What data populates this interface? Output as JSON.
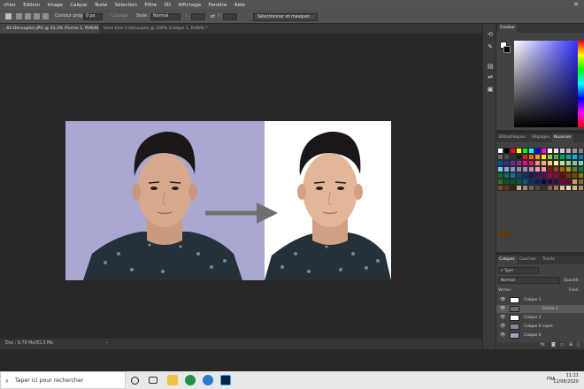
{
  "menubar": {
    "items": [
      "chier",
      "Edition",
      "Image",
      "Calque",
      "Texte",
      "Sélection",
      "Filtre",
      "3D",
      "Affichage",
      "Fenêtre",
      "Aide"
    ],
    "close_glyph": "✕"
  },
  "options": {
    "contour_label": "Contour progr. :",
    "contour_value": "0 px",
    "lissage": "Lissage",
    "style_label": "Style :",
    "style_value": "Normal",
    "l_label": "L :",
    "h_label": "H :",
    "select_mask_button": "Sélectionner et masquer..."
  },
  "tabs": [
    {
      "label": "...60-Découpée).JPG @ 33,3% (Forme 1, RVB/8) *",
      "active": true
    },
    {
      "label": "Sans titre-1-Découpée @ 100% (Calque 1, RVB/8) *",
      "active": false
    }
  ],
  "status": {
    "text": "Doc : 9,79 Mo/83,3 Mo"
  },
  "panels": {
    "color_tab": "Couleur",
    "library_tabs": [
      "Bibliothèques",
      "Réglages",
      "Nuancier"
    ],
    "layer_tabs": [
      "Calques",
      "Couches",
      "Tracés"
    ],
    "filter_kind": "Type",
    "blend_mode": "Normal",
    "opacity_label": "Opacité :",
    "lock_label": "Verrou :",
    "fill_label": "Fond :",
    "layers": [
      {
        "name": "Calque 1",
        "selected": false
      },
      {
        "name": "Forme 1",
        "selected": true
      },
      {
        "name": "Calque 2",
        "selected": false
      },
      {
        "name": "Calque 0 copie",
        "selected": false
      },
      {
        "name": "Calque 0",
        "selected": false
      }
    ]
  },
  "swatch_colors": [
    "#ffffff",
    "#000000",
    "#ff0000",
    "#ffff00",
    "#00ff00",
    "#00ffff",
    "#0000ff",
    "#ff00ff",
    "#ffffff",
    "#e6e6e6",
    "#cccccc",
    "#b3b3b3",
    "#999999",
    "#808080",
    "#666666",
    "#4d4d4d",
    "#333333",
    "#1a1a1a",
    "#ed1c24",
    "#f26522",
    "#f7941d",
    "#fff200",
    "#8dc63f",
    "#39b54a",
    "#00a651",
    "#00a99d",
    "#00aeef",
    "#0072bc",
    "#0054a6",
    "#2e3192",
    "#662d91",
    "#92278f",
    "#ec008c",
    "#ed145b",
    "#f69679",
    "#f9ad81",
    "#fdc68a",
    "#fff79a",
    "#c4df9b",
    "#a3d39c",
    "#82ca9d",
    "#7accc8",
    "#6dcff6",
    "#7da7d9",
    "#8393ca",
    "#8781bd",
    "#a186be",
    "#bd8cbf",
    "#f49ac2",
    "#f5989d",
    "#9e0b0f",
    "#a0410d",
    "#a36209",
    "#aba000",
    "#598527",
    "#197b30",
    "#007236",
    "#00746b",
    "#0076a3",
    "#004a80",
    "#003471",
    "#1b1464",
    "#440e62",
    "#630460",
    "#9e005d",
    "#9e0039",
    "#790000",
    "#7b2e00",
    "#7d4900",
    "#827b00",
    "#406618",
    "#005e20",
    "#005826",
    "#005952",
    "#005b7f",
    "#003663",
    "#002157",
    "#0d004c",
    "#32004b",
    "#4b0049",
    "#7b0046",
    "#7a0026",
    "#c69c6d",
    "#8c6239",
    "#754c24",
    "#603913",
    "#3c2415",
    "#c7b299",
    "#998675",
    "#736357",
    "#534741",
    "#362f2d",
    "#8b5e3c",
    "#a67c52",
    "#e0c49b",
    "#f0d9b5",
    "#d8b98c",
    "#b5895a"
  ],
  "taskbar": {
    "search_placeholder": "Taper ici pour rechercher",
    "lang": "FRA",
    "time": "11:21",
    "date": "12/08/2020"
  },
  "colors": {
    "canvas_bg": "#282828",
    "panel_bg": "#424242",
    "left_photo_bg": "#a8a8d2",
    "arrow": "#6f6f6f"
  }
}
